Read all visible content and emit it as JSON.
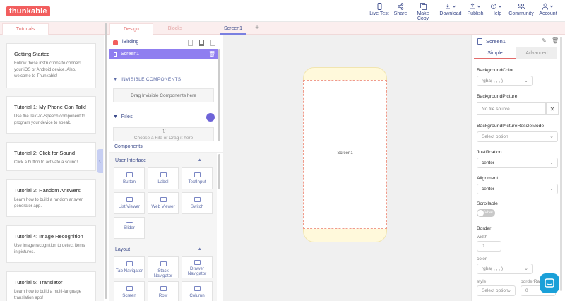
{
  "brand": "thunkable",
  "nav": [
    {
      "label": "Live Test",
      "icon": "phone-icon"
    },
    {
      "label": "Share",
      "icon": "share-icon"
    },
    {
      "label": "Make Copy",
      "icon": "copy-icon"
    },
    {
      "label": "Download",
      "icon": "download-icon"
    },
    {
      "label": "Publish",
      "icon": "upload-icon"
    },
    {
      "label": "Help",
      "icon": "help-icon"
    },
    {
      "label": "Community",
      "icon": "community-icon"
    },
    {
      "label": "Account",
      "icon": "account-icon"
    }
  ],
  "tabs": {
    "tutorials": "Tutorials",
    "design": "Design",
    "blocks": "Blocks",
    "screen": "Screen1",
    "add": "+"
  },
  "tutorials": [
    {
      "title": "Getting Started",
      "desc": "Follow these instructions to connect your iOS or Android device. Also, welcome to Thunkable!"
    },
    {
      "title": "Tutorial 1: My Phone Can Talk!",
      "desc": "Use the Text-to-Speech component to program your device to speak."
    },
    {
      "title": "Tutorial 2: Click for Sound",
      "desc": "Click a button to activate a sound!"
    },
    {
      "title": "Tutorial 3: Random Answers",
      "desc": "Learn how to build a random answer generator app."
    },
    {
      "title": "Tutorial 4: Image Recognition",
      "desc": "Use image recognition to detect items in pictures."
    },
    {
      "title": "Tutorial 5: Translator",
      "desc": "Learn how to build a multi-language translation app!"
    }
  ],
  "tree": {
    "app_name": "iBirding",
    "screen": "Screen1"
  },
  "invisible": {
    "header": "INVISIBLE COMPONENTS",
    "drop_text": "Drag Invisible Components here"
  },
  "files": {
    "header": "Files",
    "drop_text": "Choose a File or Drag it here"
  },
  "components": {
    "header": "Components",
    "ui_header": "User Interface",
    "ui_tiles": [
      "Button",
      "Label",
      "TextInput",
      "List Viewer",
      "Web Viewer",
      "Switch",
      "Slider"
    ],
    "layout_header": "Layout",
    "layout_tiles": [
      "Tab Navigator",
      "Stack Navigator",
      "Drawer Navigator",
      "Screen",
      "Row",
      "Column"
    ]
  },
  "canvas": {
    "screen_label": "Screen1"
  },
  "properties": {
    "title": "Screen1",
    "tab_simple": "Simple",
    "tab_advanced": "Advanced",
    "bg_color_label": "BackgroundColor",
    "bg_color_value": "rgba( , , , )",
    "bg_picture_label": "BackgroundPicture",
    "bg_picture_value": "No file source",
    "bg_resize_label": "BackgroundPictureResizeMode",
    "bg_resize_value": "Select option",
    "justification_label": "Justification",
    "justification_value": "center",
    "alignment_label": "Alignment",
    "alignment_value": "center",
    "scrollable_label": "Scrollable",
    "scrollable_value": "false",
    "border_label": "Border",
    "width_label": "width",
    "width_value": "0",
    "color_label": "color",
    "color_value": "rgba( , , , )",
    "style_label": "style",
    "style_value": "Select option",
    "radius_label": "borderRad",
    "radius_value": "0"
  },
  "colors": {
    "brand": "#f25e5e",
    "accent": "#8f7ef0",
    "nav_text": "#3b4a8a"
  }
}
